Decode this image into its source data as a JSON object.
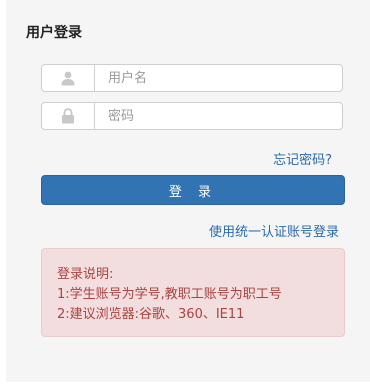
{
  "page": {
    "title": "用户登录"
  },
  "form": {
    "username_placeholder": "用户名",
    "username_value": "",
    "password_placeholder": "密码",
    "password_value": "",
    "forgot_label": "忘记密码?",
    "login_label": "登 录",
    "unified_login_label": "使用统一认证账号登录"
  },
  "notice": {
    "heading": "登录说明:",
    "lines": [
      "1:学生账号为学号,教职工账号为职工号",
      "2:建议浏览器:谷歌、360、IE11"
    ]
  },
  "icons": {
    "username": "user-icon",
    "password": "lock-icon"
  },
  "colors": {
    "primary": "#3273b3",
    "link": "#2b6aa8",
    "notice_bg": "#f2dede",
    "notice_text": "#a94442"
  }
}
